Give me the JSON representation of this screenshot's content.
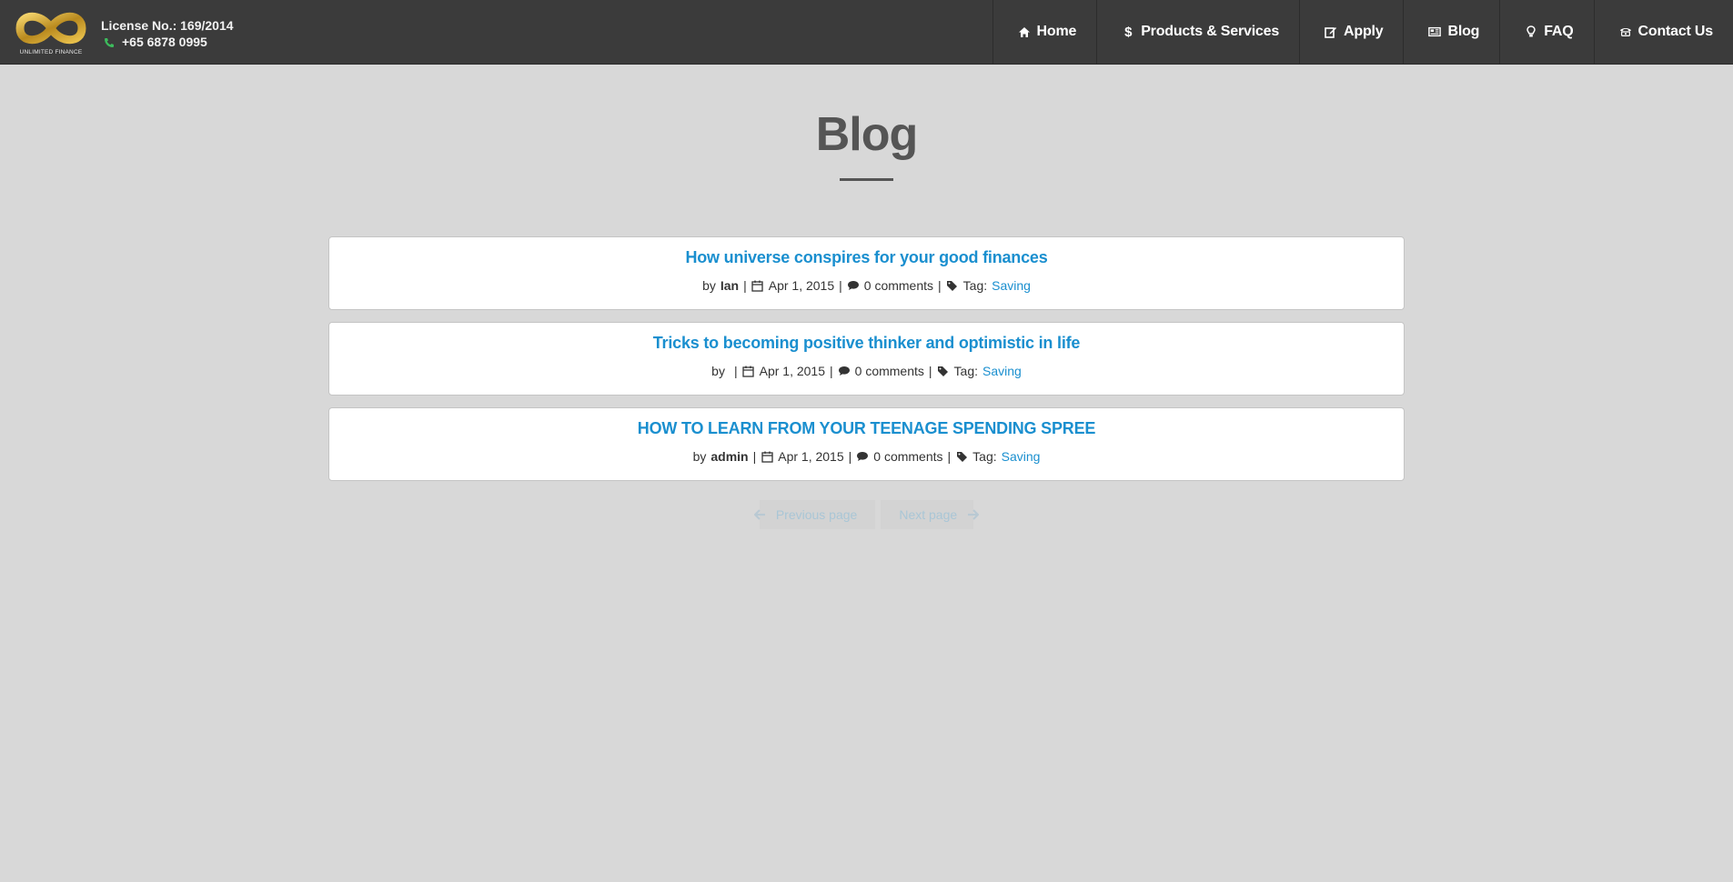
{
  "header": {
    "logo_text": "UNLIMITED FINANCE",
    "license": "License No.: 169/2014",
    "phone": "+65 6878 0995",
    "nav": [
      {
        "label": "Home",
        "icon": "home-icon"
      },
      {
        "label": "Products & Services",
        "icon": "dollar-icon"
      },
      {
        "label": "Apply",
        "icon": "edit-icon"
      },
      {
        "label": "Blog",
        "icon": "newspaper-icon"
      },
      {
        "label": "FAQ",
        "icon": "lightbulb-icon"
      },
      {
        "label": "Contact Us",
        "icon": "phone-icon"
      }
    ]
  },
  "page": {
    "title": "Blog"
  },
  "posts": [
    {
      "title": "How universe conspires for your good finances",
      "by": "by",
      "author": "Ian",
      "date": "Apr 1, 2015",
      "comments": "0 comments",
      "tag_label": "Tag:",
      "tag": "Saving"
    },
    {
      "title": "Tricks to becoming positive thinker and optimistic in life",
      "by": "by",
      "author": "",
      "date": "Apr 1, 2015",
      "comments": "0 comments",
      "tag_label": "Tag:",
      "tag": "Saving"
    },
    {
      "title": "HOW TO LEARN FROM YOUR TEENAGE SPENDING SPREE",
      "by": "by",
      "author": "admin",
      "date": "Apr 1, 2015",
      "comments": "0 comments",
      "tag_label": "Tag:",
      "tag": "Saving"
    }
  ],
  "pager": {
    "previous": "Previous page",
    "next": "Next page"
  },
  "colors": {
    "header_bg": "#3b3b3b",
    "page_bg": "#d8d8d8",
    "link": "#1a8fcf",
    "logo_gold": "#c9a227",
    "phone_green": "#3dbb5c"
  }
}
